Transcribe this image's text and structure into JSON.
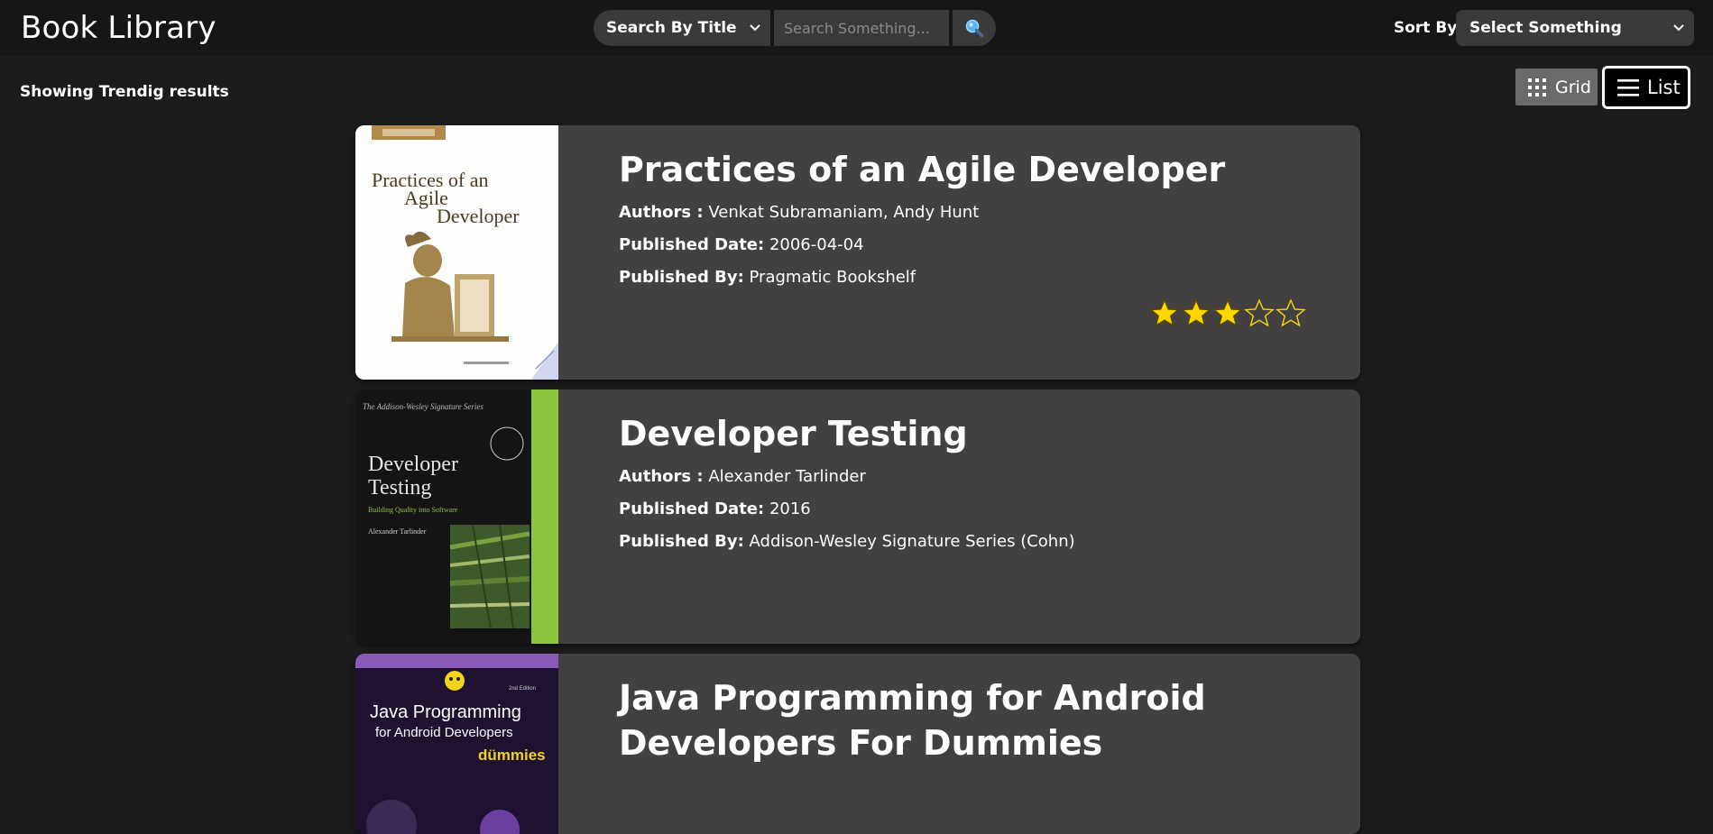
{
  "header": {
    "title": "Book Library",
    "search_type_selected": "Search By Title",
    "search_placeholder": "Search Something...",
    "search_button_icon": "magnifier-icon",
    "sort_label": "Sort By",
    "sort_selected": "Select Something"
  },
  "toolbar": {
    "results_text": "Showing Trendig results",
    "grid_label": "Grid",
    "list_label": "List",
    "active_view": "list"
  },
  "colors": {
    "background": "#1c1c1c",
    "navbar": "#161616",
    "card": "#424041",
    "star": "#ffd700"
  },
  "books": [
    {
      "title": "Practices of an Agile Developer",
      "authors_label": "Authors :",
      "authors": "Venkat Subramaniam, Andy Hunt",
      "date_label": "Published Date:",
      "date": "2006-04-04",
      "publisher_label": "Published By:",
      "publisher": "Pragmatic Bookshelf",
      "rating": 3,
      "rating_max": 5,
      "cover": {
        "line1": "Practices of an",
        "line2": "Agile",
        "line3": "Developer"
      }
    },
    {
      "title": "Developer Testing",
      "authors_label": "Authors :",
      "authors": "Alexander Tarlinder",
      "date_label": "Published Date:",
      "date": "2016",
      "publisher_label": "Published By:",
      "publisher": "Addison-Wesley Signature Series (Cohn)",
      "rating": null,
      "cover": {
        "series": "The Addison-Wesley Signature Series",
        "line1": "Developer",
        "line2": "Testing",
        "subtitle": "Building Quality into Software",
        "author": "Alexander Tarlinder"
      }
    },
    {
      "title": "Java Programming for Android Developers For Dummies",
      "cover": {
        "line1": "Java Programming",
        "line2": "for Android Developers",
        "brand": "dümmies",
        "edition": "2nd Edition"
      }
    }
  ]
}
